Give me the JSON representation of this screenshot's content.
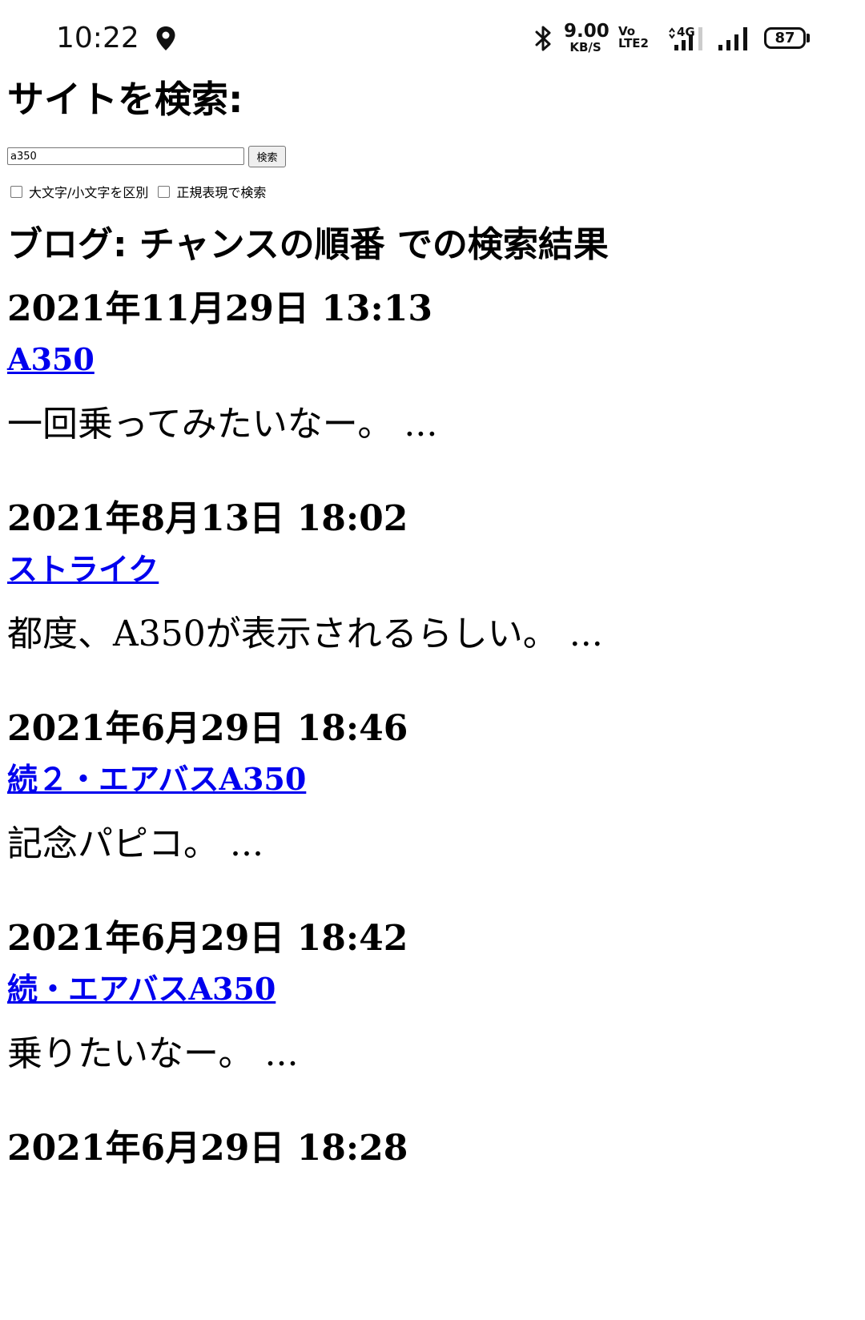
{
  "status_bar": {
    "time": "10:22",
    "net_speed_value": "9.00",
    "net_speed_unit": "KB/S",
    "volte_top": "Vo",
    "volte_bottom": "LTE2",
    "network_type": "4G",
    "battery_level": "87",
    "icons": [
      "location-icon",
      "bluetooth-icon",
      "signal-icon",
      "battery-icon"
    ]
  },
  "search": {
    "title": "サイトを検索:",
    "query": "a350",
    "button_label": "検索",
    "option_case": "大文字/小文字を区別",
    "option_regex": "正規表現で検索"
  },
  "results": {
    "heading": "ブログ: チャンスの順番 での検索結果",
    "items": [
      {
        "date": "2021年11月29日 13:13",
        "title": "A350",
        "snippet": "一回乗ってみたいなー。 ..."
      },
      {
        "date": "2021年8月13日 18:02",
        "title": "ストライク",
        "snippet": "都度、A350が表示されるらしい。 ..."
      },
      {
        "date": "2021年6月29日 18:46",
        "title": "続２・エアバスA350",
        "snippet": "記念パピコ。 ..."
      },
      {
        "date": "2021年6月29日 18:42",
        "title": "続・エアバスA350",
        "snippet": "乗りたいなー。 ..."
      },
      {
        "date": "2021年6月29日 18:28",
        "title": "",
        "snippet": ""
      }
    ]
  },
  "colors": {
    "link": "#0000ee",
    "text": "#000000",
    "background": "#ffffff"
  }
}
